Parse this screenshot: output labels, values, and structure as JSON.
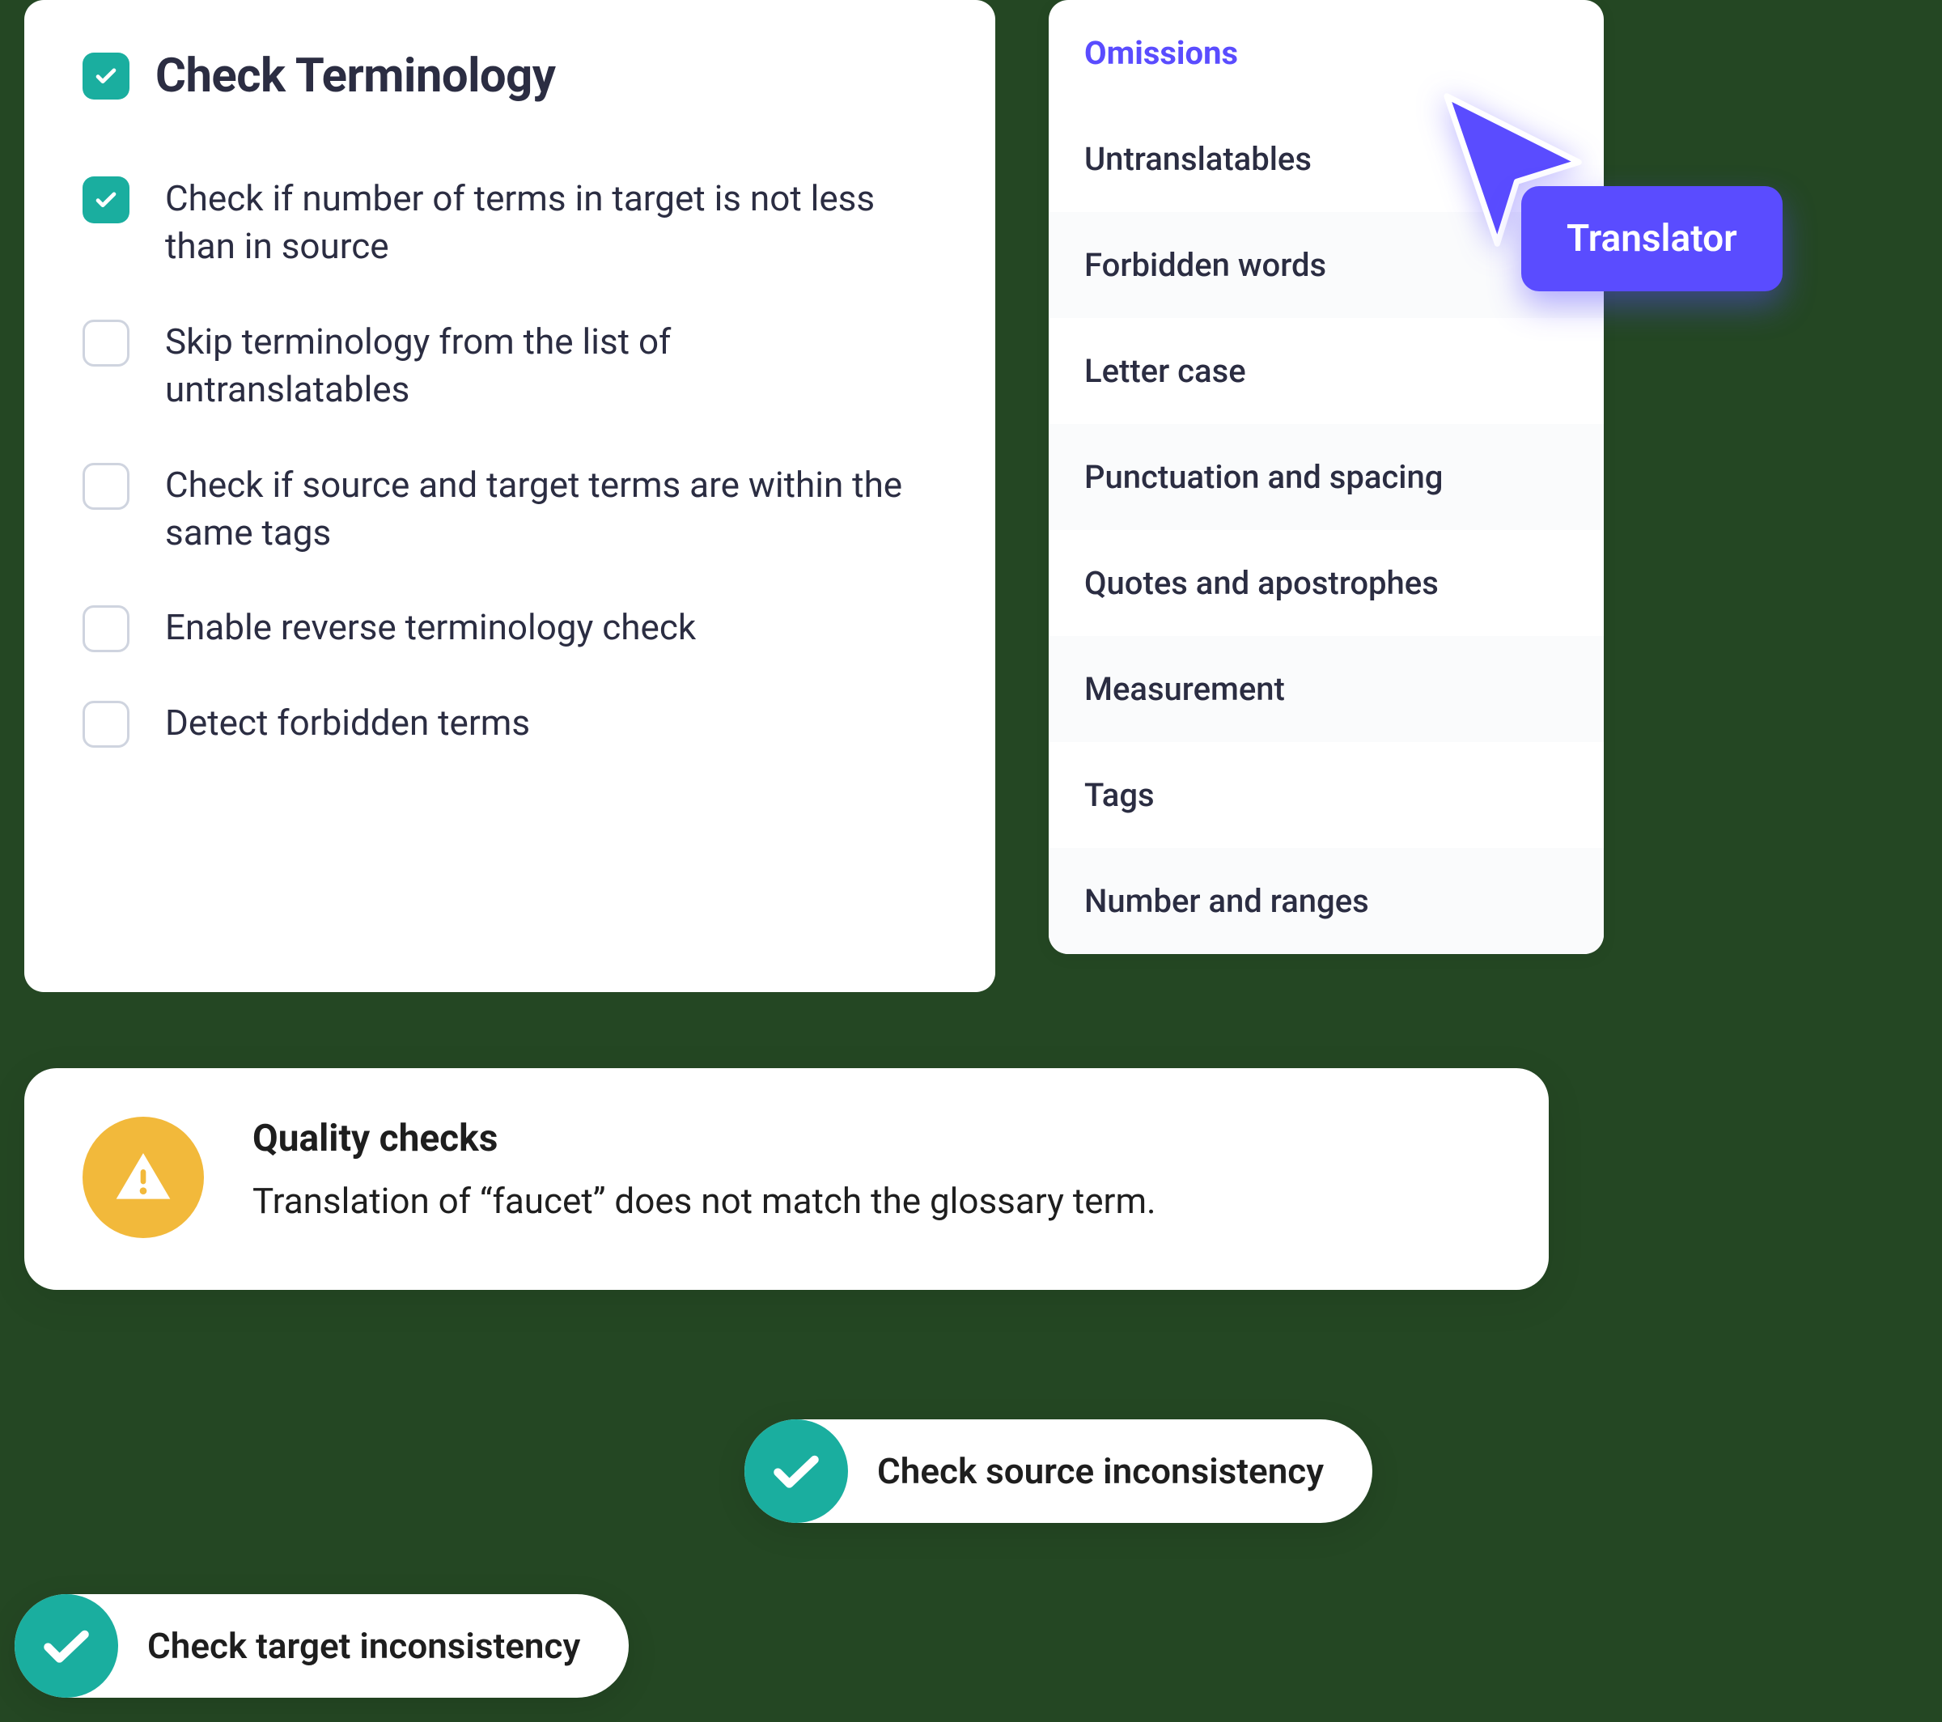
{
  "terminology": {
    "title": "Check Terminology",
    "options": [
      {
        "label": "Check if number of terms in target is not less than in source",
        "checked": true
      },
      {
        "label": "Skip terminology from the list of untranslatables",
        "checked": false
      },
      {
        "label": "Check if source and target terms are within the same tags",
        "checked": false
      },
      {
        "label": "Enable reverse terminology check",
        "checked": false
      },
      {
        "label": "Detect forbidden terms",
        "checked": false
      }
    ]
  },
  "categories": {
    "items": [
      {
        "label": "Omissions",
        "active": true
      },
      {
        "label": "Untranslatables",
        "active": false
      },
      {
        "label": "Forbidden words",
        "active": false
      },
      {
        "label": "Letter case",
        "active": false
      },
      {
        "label": "Punctuation and spacing",
        "active": false
      },
      {
        "label": "Quotes and apostrophes",
        "active": false
      },
      {
        "label": "Measurement",
        "active": false
      },
      {
        "label": "Tags",
        "active": false
      },
      {
        "label": "Number and ranges",
        "active": false
      }
    ]
  },
  "translator_pill": {
    "label": "Translator"
  },
  "quality": {
    "title": "Quality checks",
    "message": "Translation of “faucet” does not match the glossary term."
  },
  "pills": {
    "source": "Check source inconsistency",
    "target": "Check target inconsistency"
  },
  "colors": {
    "accent_teal": "#1aae9f",
    "accent_purple": "#5a4cff",
    "warn_yellow": "#f2b93b"
  }
}
